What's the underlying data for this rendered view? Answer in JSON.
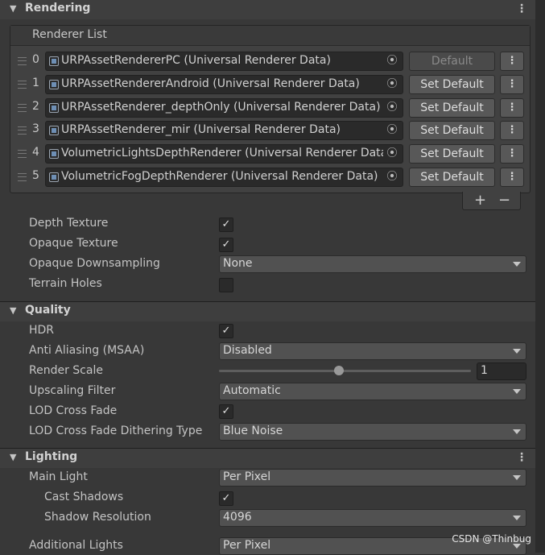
{
  "sections": {
    "rendering": {
      "title": "Rendering"
    },
    "quality": {
      "title": "Quality"
    },
    "lighting": {
      "title": "Lighting"
    }
  },
  "renderer_list": {
    "title": "Renderer List",
    "items": [
      {
        "index": "0",
        "name": "URPAssetRendererPC (Universal Renderer Data)",
        "button": "Default",
        "disabled": true
      },
      {
        "index": "1",
        "name": "URPAssetRendererAndroid (Universal Renderer Data)",
        "button": "Set Default"
      },
      {
        "index": "2",
        "name": "URPAssetRenderer_depthOnly (Universal Renderer Data)",
        "button": "Set Default"
      },
      {
        "index": "3",
        "name": "URPAssetRenderer_mir (Universal Renderer Data)",
        "button": "Set Default"
      },
      {
        "index": "4",
        "name": "VolumetricLightsDepthRenderer (Universal Renderer Data)",
        "button": "Set Default"
      },
      {
        "index": "5",
        "name": "VolumetricFogDepthRenderer (Universal Renderer Data)",
        "button": "Set Default"
      }
    ],
    "add": "+",
    "remove": "−"
  },
  "rendering": {
    "depth_texture": {
      "label": "Depth Texture",
      "checked": true
    },
    "opaque_texture": {
      "label": "Opaque Texture",
      "checked": true
    },
    "opaque_downsampling": {
      "label": "Opaque Downsampling",
      "value": "None"
    },
    "terrain_holes": {
      "label": "Terrain Holes",
      "checked": false
    }
  },
  "quality": {
    "hdr": {
      "label": "HDR",
      "checked": true
    },
    "anti_aliasing": {
      "label": "Anti Aliasing (MSAA)",
      "value": "Disabled"
    },
    "render_scale": {
      "label": "Render Scale",
      "value": "1",
      "slider_fraction": 0.47
    },
    "upscaling_filter": {
      "label": "Upscaling Filter",
      "value": "Automatic"
    },
    "lod_cross_fade": {
      "label": "LOD Cross Fade",
      "checked": true
    },
    "lod_dither": {
      "label": "LOD Cross Fade Dithering Type",
      "value": "Blue Noise"
    }
  },
  "lighting": {
    "main_light": {
      "label": "Main Light",
      "value": "Per Pixel"
    },
    "cast_shadows": {
      "label": "Cast Shadows",
      "checked": true
    },
    "shadow_resolution": {
      "label": "Shadow Resolution",
      "value": "4096"
    },
    "additional_lights": {
      "label": "Additional Lights",
      "value": "Per Pixel"
    }
  },
  "icons": {
    "menu": "⋮",
    "check": "✓",
    "picker": "⦿",
    "collapse": "▼"
  },
  "watermark": "CSDN @Thinbug"
}
